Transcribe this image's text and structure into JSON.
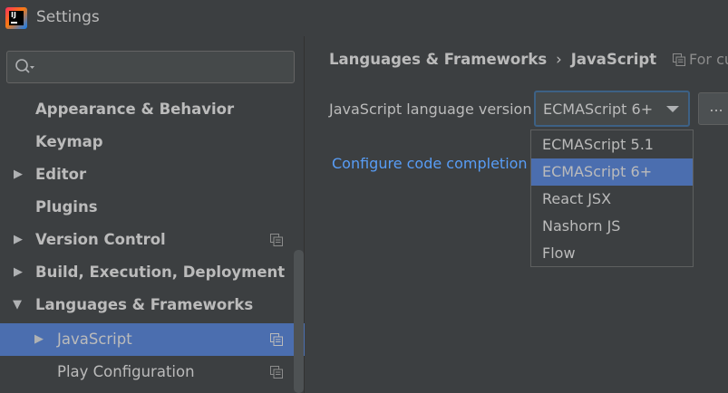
{
  "window": {
    "title": "Settings"
  },
  "sidebar": {
    "search": {
      "placeholder": ""
    },
    "items": [
      {
        "label": "Appearance & Behavior"
      },
      {
        "label": "Keymap"
      },
      {
        "label": "Editor"
      },
      {
        "label": "Plugins"
      },
      {
        "label": "Version Control"
      },
      {
        "label": "Build, Execution, Deployment"
      },
      {
        "label": "Languages & Frameworks"
      },
      {
        "label": "JavaScript"
      },
      {
        "label": "Play Configuration"
      }
    ]
  },
  "main": {
    "breadcrumb": {
      "parent": "Languages & Frameworks",
      "separator": "›",
      "current": "JavaScript"
    },
    "for_current_label": "For cu",
    "language_version_label": "JavaScript language version",
    "language_version_value": "ECMAScript 6+",
    "ellipsis_label": "...",
    "configure_link": "Configure code completion s"
  },
  "dropdown": {
    "options": [
      "ECMAScript 5.1",
      "ECMAScript 6+",
      "React JSX",
      "Nashorn JS",
      "Flow"
    ],
    "selected": "ECMAScript 6+"
  },
  "colors": {
    "background": "#3c3f41",
    "selection": "#4b6eaf",
    "link": "#589df6",
    "text": "#bbbbbb"
  }
}
